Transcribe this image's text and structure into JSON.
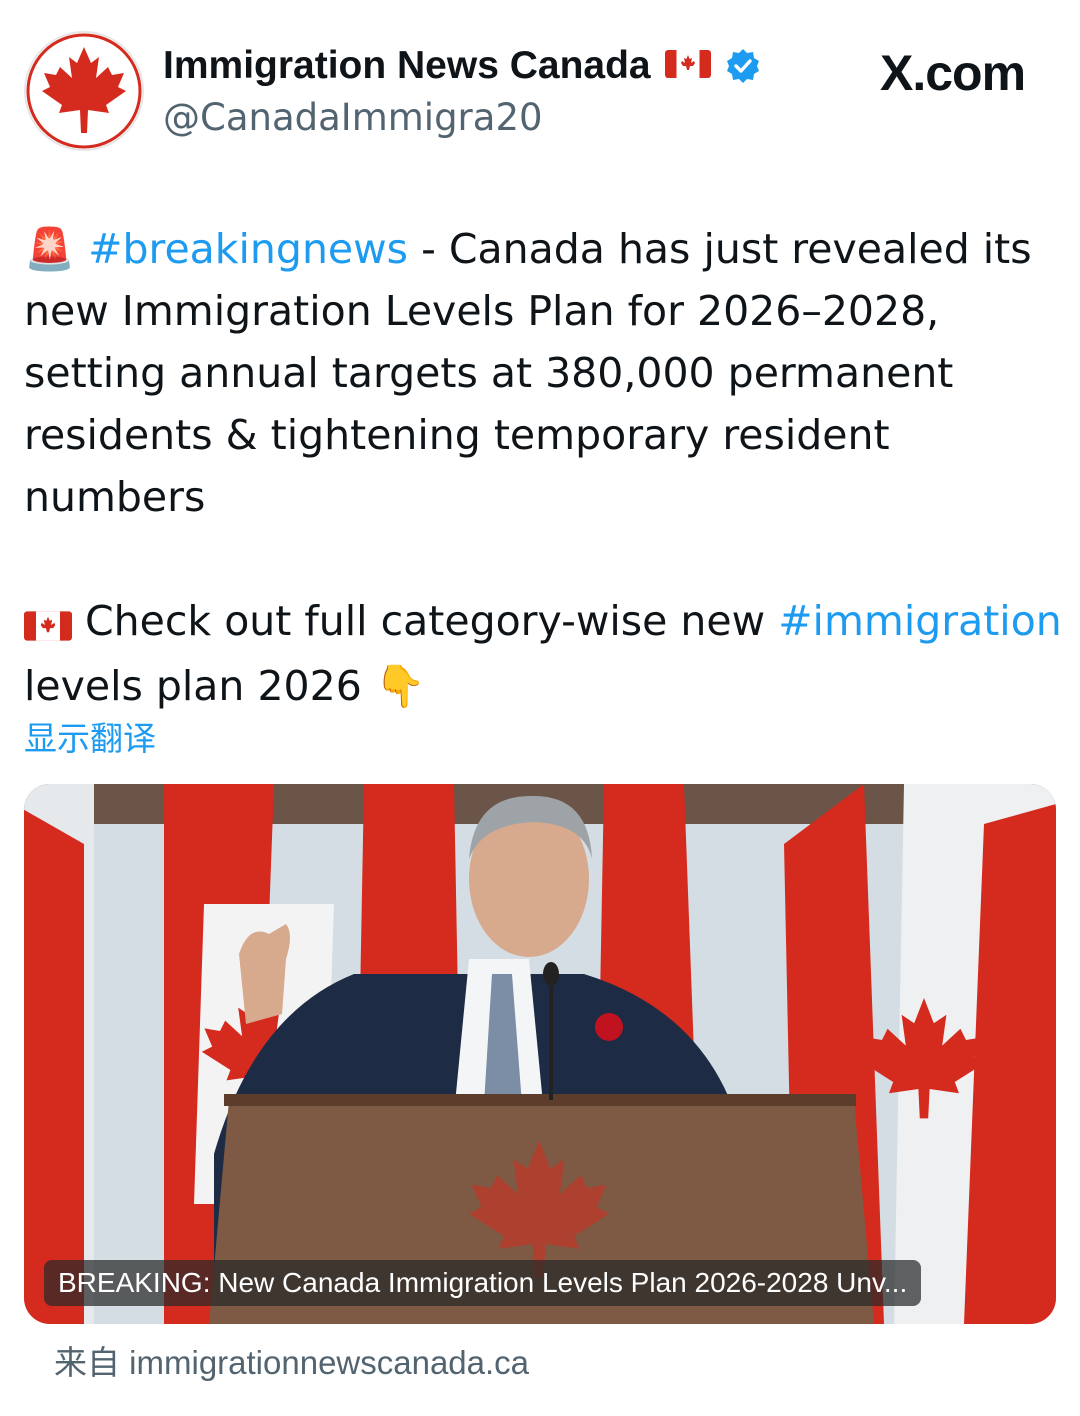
{
  "account": {
    "display_name": "Immigration News Canada",
    "handle": "@CanadaImmigra20",
    "verified": true,
    "avatar_icon": "maple-leaf-icon",
    "flag_icon": "canada-flag-icon"
  },
  "brand": {
    "site": "X.com"
  },
  "tweet": {
    "para1_emoji": "🚨",
    "hashtag1": "#breakingnews",
    "para1_text": " - Canada has just revealed its new Immigration Levels Plan for 2026–2028, setting annual targets at 380,000 permanent residents & tightening temporary resident numbers",
    "para2_text": " Check out full category-wise new ",
    "hashtag2": "#immigration",
    "para2_tail": " levels plan 2026 ",
    "para2_emoji": "👇"
  },
  "translate_link": "显示翻译",
  "media": {
    "caption": "BREAKING: New Canada Immigration Levels Plan 2026-2028 Unv..."
  },
  "source": {
    "prefix": "来自",
    "domain": "immigrationnewscanada.ca"
  },
  "colors": {
    "link": "#1d9bf0",
    "text": "#0f1419",
    "secondary": "#536471",
    "canada_red": "#d52b1e"
  }
}
